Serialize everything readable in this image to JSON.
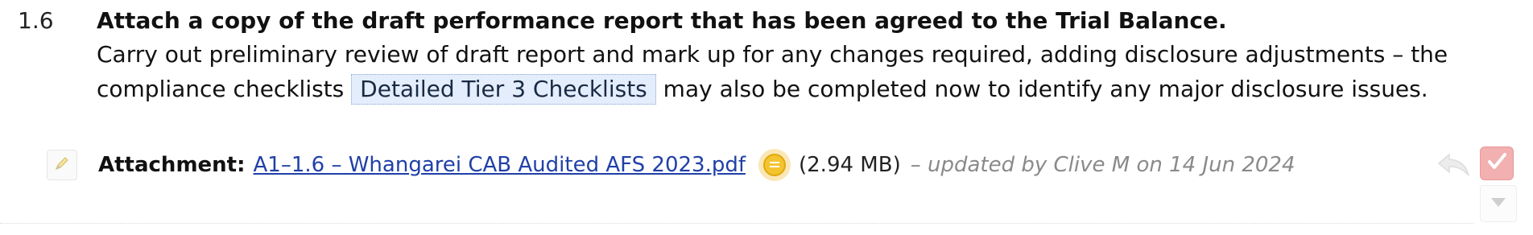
{
  "step": {
    "number": "1.6",
    "title": "Attach a copy of the draft performance report that has been agreed to the Trial Balance.",
    "description_before": "Carry out preliminary review of draft report and mark up for any changes required, adding disclosure adjustments – the compliance checklists",
    "checklist_link": "Detailed Tier 3 Checklists",
    "description_after": "may also be completed now to identify any major disclosure issues."
  },
  "attachment": {
    "label": "Attachment:",
    "file_name": "A1–1.6 – Whangarei CAB Audited AFS 2023.pdf",
    "size": "(2.94 MB)",
    "updated": "– updated by Clive M on 14 Jun 2024"
  },
  "icons": {
    "edit": "pencil-icon",
    "comment": "comment-icon",
    "reply": "reply-arrow-icon",
    "signoff": "checkmark-icon",
    "expand": "triangle-down-icon"
  },
  "colors": {
    "link": "#2040a8",
    "highlight": "#e4edfb",
    "comment_badge": "#f4c430",
    "signoff": "#f2b0b0"
  }
}
